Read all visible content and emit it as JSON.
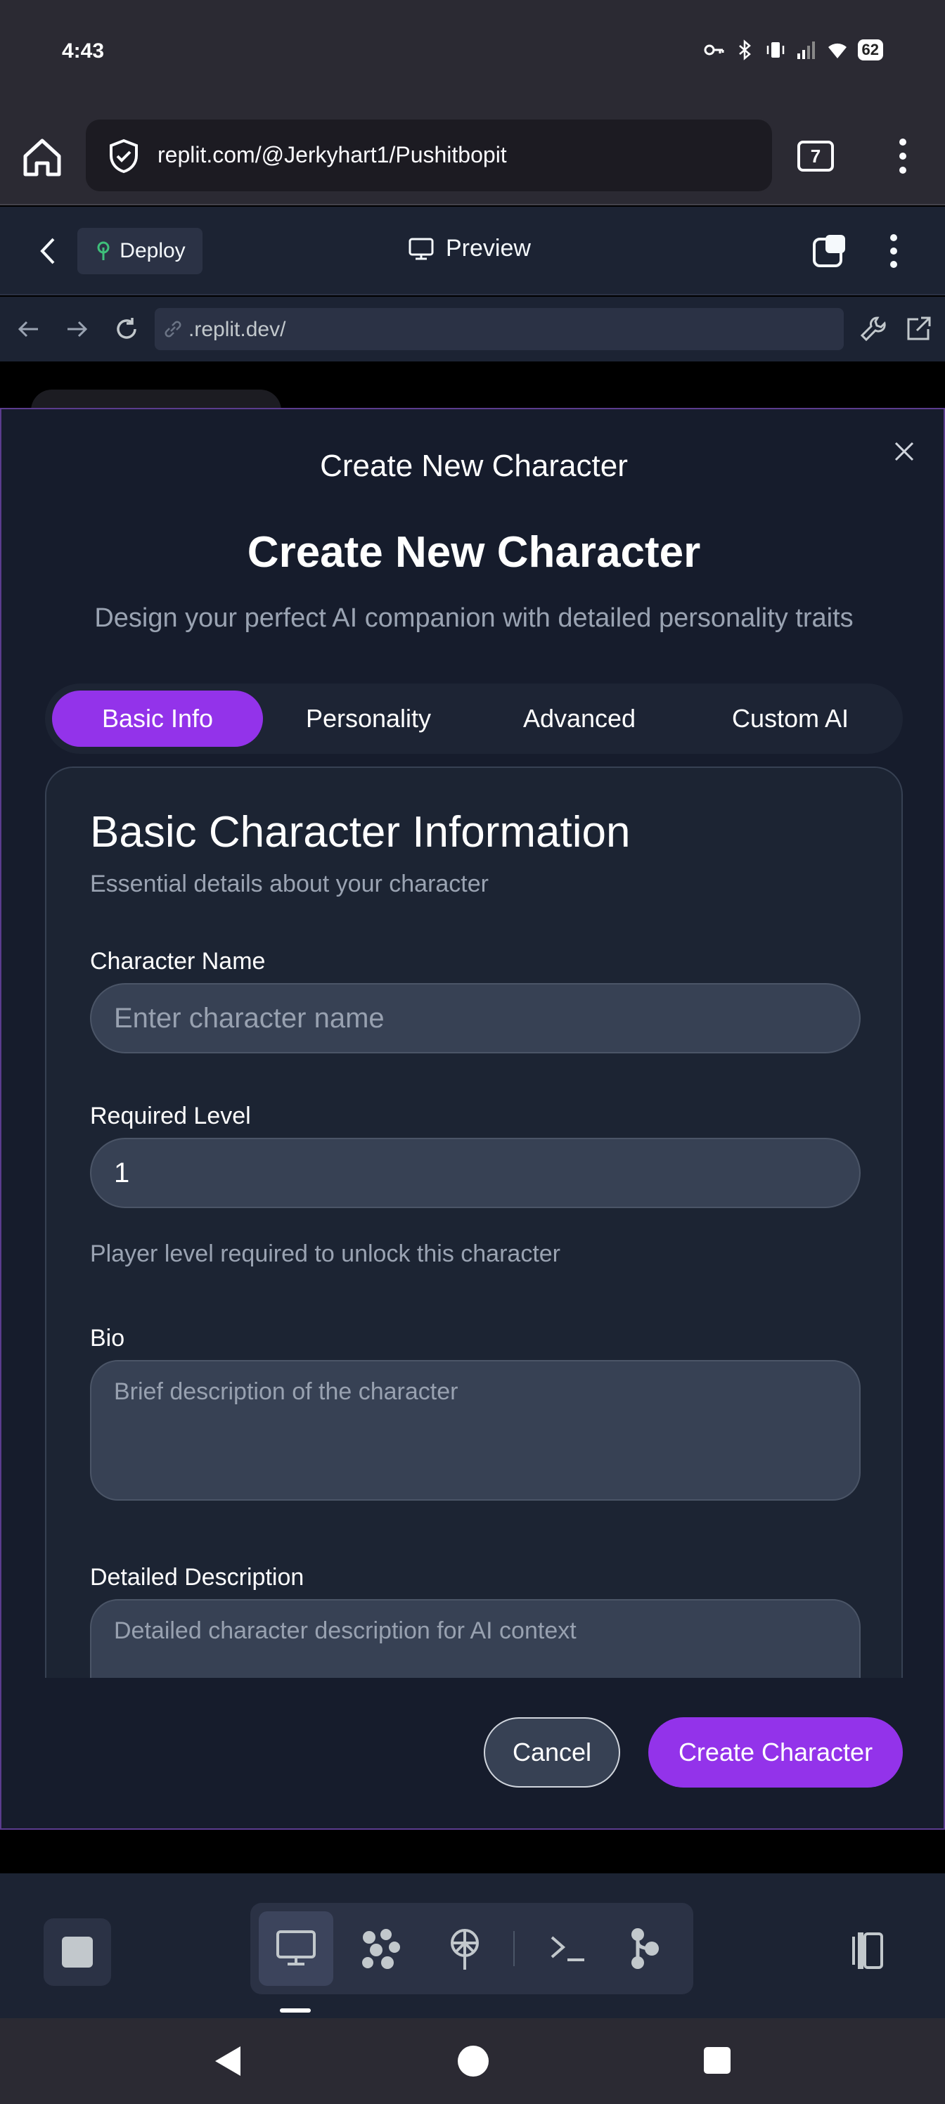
{
  "status_bar": {
    "time": "4:43",
    "battery": "62"
  },
  "browser": {
    "url": "replit.com/@Jerkyhart1/Pushitbopit",
    "tab_count": "7"
  },
  "replit_header": {
    "deploy_label": "Deploy",
    "preview_label": "Preview"
  },
  "webview": {
    "url": ".replit.dev/"
  },
  "modal": {
    "header_title": "Create New Character",
    "title": "Create New Character",
    "subtitle": "Design your perfect AI companion with detailed personality traits",
    "tabs": [
      {
        "label": "Basic Info",
        "active": true
      },
      {
        "label": "Personality",
        "active": false
      },
      {
        "label": "Advanced",
        "active": false
      },
      {
        "label": "Custom AI",
        "active": false
      }
    ],
    "section": {
      "title": "Basic Character Information",
      "description": "Essential details about your character"
    },
    "fields": {
      "name": {
        "label": "Character Name",
        "placeholder": "Enter character name",
        "value": ""
      },
      "level": {
        "label": "Required Level",
        "value": "1",
        "help": "Player level required to unlock this character"
      },
      "bio": {
        "label": "Bio",
        "placeholder": "Brief description of the character",
        "value": ""
      },
      "description": {
        "label": "Detailed Description",
        "placeholder": "Detailed character description for AI context",
        "value": ""
      }
    },
    "buttons": {
      "cancel": "Cancel",
      "create": "Create Character"
    }
  },
  "colors": {
    "accent": "#9333ea",
    "surface": "#1c2333",
    "input_bg": "#374154"
  },
  "bottom_toolbar": {
    "tools": [
      "preview-icon",
      "apps-grid-icon",
      "deploy-antenna-icon",
      "shell-icon",
      "git-icon"
    ]
  }
}
